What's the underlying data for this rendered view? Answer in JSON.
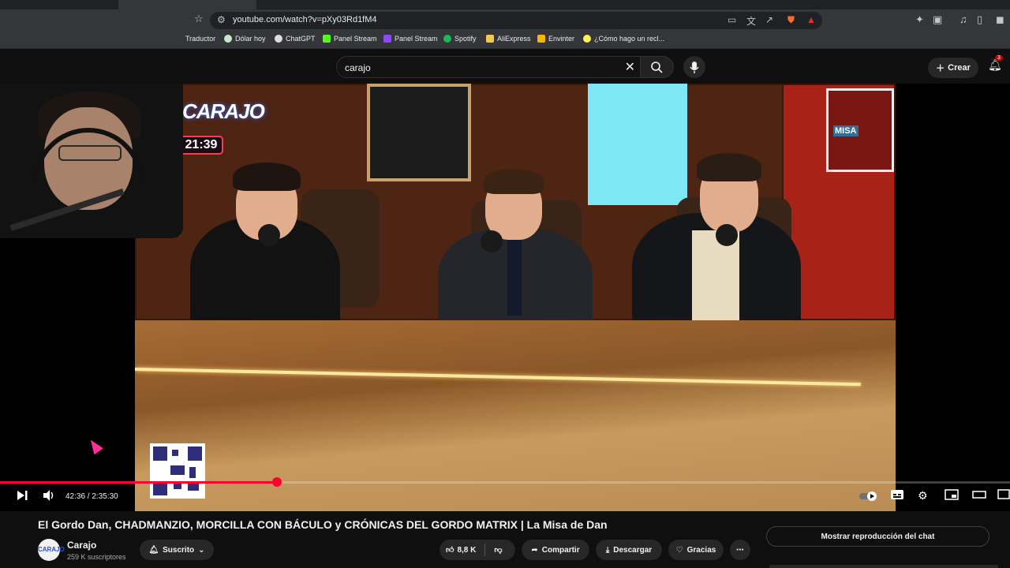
{
  "browser": {
    "url": "youtube.com/watch?v=pXy03Rd1fM4",
    "bookmarks": [
      {
        "label": "Traductor",
        "icon": "translate-icon"
      },
      {
        "label": "Dólar hoy",
        "icon": "dollar-icon"
      },
      {
        "label": "ChatGPT",
        "icon": "chatgpt-icon"
      },
      {
        "label": "Panel Stream",
        "icon": "kick-icon"
      },
      {
        "label": "Panel Stream",
        "icon": "twitch-icon"
      },
      {
        "label": "Spotify",
        "icon": "spotify-icon"
      },
      {
        "label": "AliExpress",
        "icon": "folder-icon"
      },
      {
        "label": "Envinter",
        "icon": "envinter-icon"
      },
      {
        "label": "¿Cómo hago un recl...",
        "icon": "mercadolibre-icon"
      }
    ]
  },
  "youtube": {
    "search_value": "carajo",
    "create_label": "Crear",
    "notifications_count": "3"
  },
  "video": {
    "overlay_brand": "CARAJO",
    "overlay_clock": "21:39",
    "poster_text": "MISA",
    "current_time": "42:36",
    "duration": "2:35:30",
    "progress_fraction": 0.274
  },
  "meta": {
    "title": "El Gordo Dan, CHADMANZIO, MORCILLA CON BÁCULO y CRÓNICAS DEL GORDO MATRIX | La Misa de Dan",
    "channel_name": "Carajo",
    "channel_subs": "259 K suscriptores",
    "avatar_text": "CARAJO",
    "subscribed_label": "Suscrito",
    "likes": "8,8 K",
    "share_label": "Compartir",
    "download_label": "Descargar",
    "thanks_label": "Gracias",
    "chat_replay_label": "Mostrar reproducción del chat"
  },
  "colors": {
    "accent_red": "#ff0033",
    "background": "#0f0f0f",
    "pill": "#272727"
  }
}
